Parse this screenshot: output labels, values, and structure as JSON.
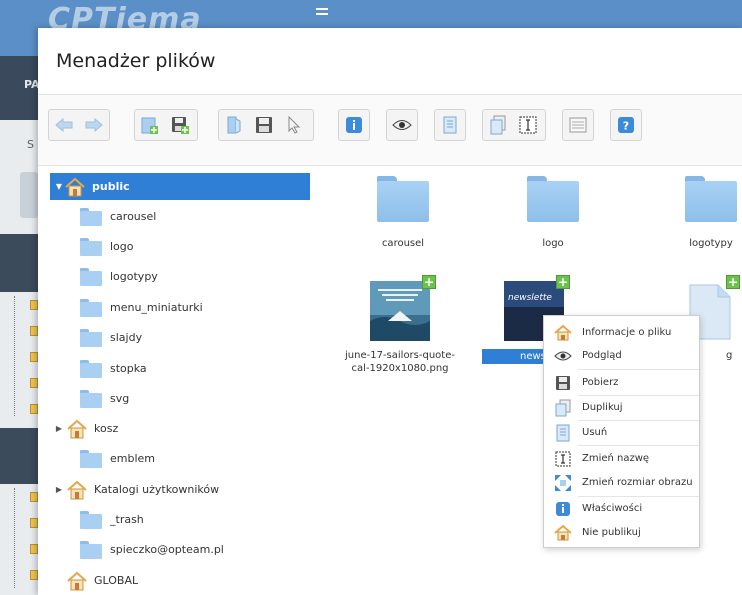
{
  "background": {
    "logo_text": "CPTiema",
    "side_label": "PA",
    "side_letter": "S"
  },
  "modal": {
    "title": "Menadżer plików"
  },
  "toolbar": {
    "groups": [
      [
        "back",
        "forward"
      ],
      [
        "new-folder",
        "upload"
      ],
      [
        "open",
        "download",
        "select"
      ],
      [
        "info"
      ],
      [
        "preview"
      ],
      [
        "delete"
      ],
      [
        "duplicate",
        "rename"
      ],
      [
        "view"
      ],
      [
        "help"
      ]
    ]
  },
  "tree": {
    "root": "public",
    "children": [
      "carousel",
      "logo",
      "logotypy",
      "menu_miniaturki",
      "slajdy",
      "stopka",
      "svg"
    ],
    "kosz": "kosz",
    "kosz_child": "emblem",
    "users": "Katalogi użytkowników",
    "users_children": [
      "_trash",
      "spieczko@opteam.pl"
    ],
    "global": "GLOBAL"
  },
  "content": {
    "folders": [
      "carousel",
      "logo",
      "logotypy"
    ],
    "files": [
      {
        "name": "june-17-sailors-quote-cal-1920x1080.png"
      },
      {
        "name": "news",
        "thumb_text": "newslette",
        "selected": true
      },
      {
        "name": "g"
      }
    ]
  },
  "context_menu": {
    "items": [
      "Informacje o pliku",
      "Podgląd",
      "Pobierz",
      "Duplikuj",
      "Usuń",
      "Zmień nazwę",
      "Zmień rozmiar obrazu",
      "Właściwości",
      "Nie publikuj"
    ]
  },
  "colors": {
    "accent": "#2f7fd6",
    "folder": "#a9d0f3",
    "topbar": "#5b8fc7"
  }
}
